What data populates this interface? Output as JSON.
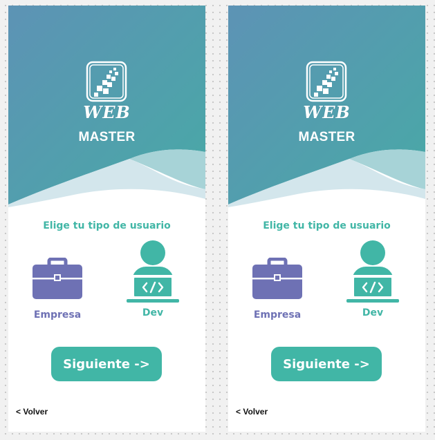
{
  "screens": [
    {
      "logo": {
        "wordmark": "WEB",
        "subtitle": "MASTER",
        "icon": "pixel-arrow-logo-icon"
      },
      "prompt": "Elige tu tipo de usuario",
      "options": [
        {
          "label": "Empresa",
          "icon": "briefcase-icon",
          "color": "#6e71b4"
        },
        {
          "label": "Dev",
          "icon": "developer-laptop-icon",
          "color": "#41b6a6"
        }
      ],
      "next_label": "Siguiente ->",
      "back_label": "< Volver"
    },
    {
      "logo": {
        "wordmark": "WEB",
        "subtitle": "MASTER",
        "icon": "pixel-arrow-logo-icon"
      },
      "prompt": "Elige tu tipo de usuario",
      "options": [
        {
          "label": "Empresa",
          "icon": "briefcase-icon",
          "color": "#6e71b4"
        },
        {
          "label": "Dev",
          "icon": "developer-laptop-icon",
          "color": "#41b6a6"
        }
      ],
      "next_label": "Siguiente ->",
      "back_label": "< Volver"
    }
  ],
  "colors": {
    "header_top": "#5b93b4",
    "header_bottom": "#4aa6a6",
    "accent_teal": "#41b6a6",
    "accent_purple": "#6e71b4",
    "wave_light": "#a6d2d6",
    "wave_pale": "#cfe5ea"
  }
}
